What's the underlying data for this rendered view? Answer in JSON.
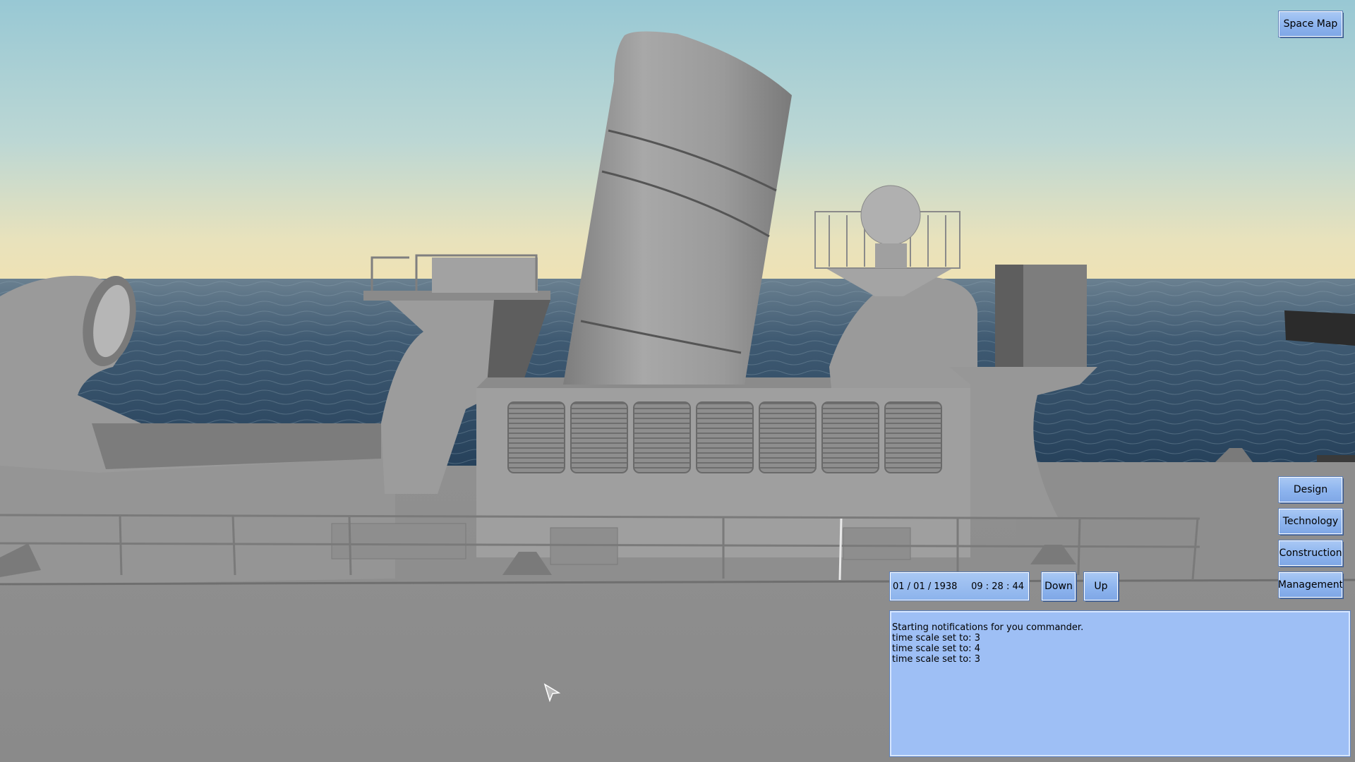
{
  "top_right": {
    "space_map_label": "Space Map"
  },
  "side_menu": {
    "items": [
      {
        "label": "Design"
      },
      {
        "label": "Technology"
      },
      {
        "label": "Construction"
      },
      {
        "label": "Management"
      }
    ]
  },
  "time_panel": {
    "date": "01 / 01 / 1938",
    "time": "09 : 28 : 44",
    "down_label": "Down",
    "up_label": "Up"
  },
  "notifications": {
    "lines": [
      "Starting notifications for you commander.",
      "time scale set to: 3",
      "time scale set to: 4",
      "time scale set to: 3"
    ]
  },
  "colors": {
    "ui_panel": "#9ebff5",
    "button": "#8db4ee",
    "ship_gray": "#8c8c8c",
    "sea": "#2e4a62",
    "sky": "#a8ced8"
  },
  "icons": {
    "cursor": "arrow-cursor-icon"
  }
}
